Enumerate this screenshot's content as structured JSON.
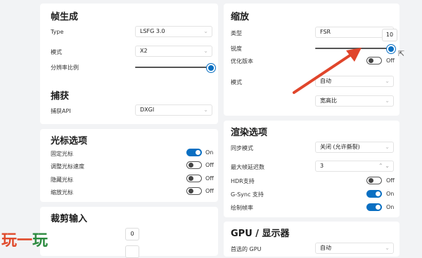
{
  "left": {
    "frame_gen": {
      "title": "帧生成",
      "type_label": "Type",
      "type_value": "LSFG 3.0",
      "mode_label": "模式",
      "mode_value": "X2",
      "resolution_label": "分辨率比例",
      "resolution_level": 1.0
    },
    "capture": {
      "title": "捕获",
      "api_label": "捕获API",
      "api_value": "DXGI"
    },
    "cursor": {
      "title": "光标选项",
      "items": [
        {
          "label": "固定光标",
          "state": "On"
        },
        {
          "label": "调整光标速度",
          "state": "Off"
        },
        {
          "label": "隐藏光标",
          "state": "Off"
        },
        {
          "label": "缩放光标",
          "state": "Off"
        }
      ]
    },
    "crop": {
      "title": "裁剪输入",
      "value": "0"
    }
  },
  "right": {
    "scaling": {
      "title": "缩放",
      "type_label": "类型",
      "type_value": "FSR",
      "sharpness_label": "锐度",
      "sharpness_value": "10",
      "sharpness_level": 1.0,
      "perf_label": "优化版本",
      "perf_state": "Off",
      "mode_label": "模式",
      "mode_value": "自动",
      "aspect_value": "宽高比"
    },
    "render": {
      "title": "渲染选项",
      "sync_label": "同步模式",
      "sync_value": "关闭 (允许撕裂)",
      "latency_label": "最大帧延迟数",
      "latency_value": "3",
      "hdr_label": "HDR支持",
      "hdr_state": "Off",
      "gsync_label": "G-Sync 支持",
      "gsync_state": "On",
      "drawrate_label": "绘制帧率",
      "drawrate_state": "On"
    },
    "gpu": {
      "title": "GPU / 显示器",
      "preferred_label": "首选的 GPU",
      "preferred_value": "自动"
    }
  },
  "watermark": "玩一玩",
  "colors": {
    "accent": "#0a6fc2",
    "arrow": "#e0452b"
  }
}
